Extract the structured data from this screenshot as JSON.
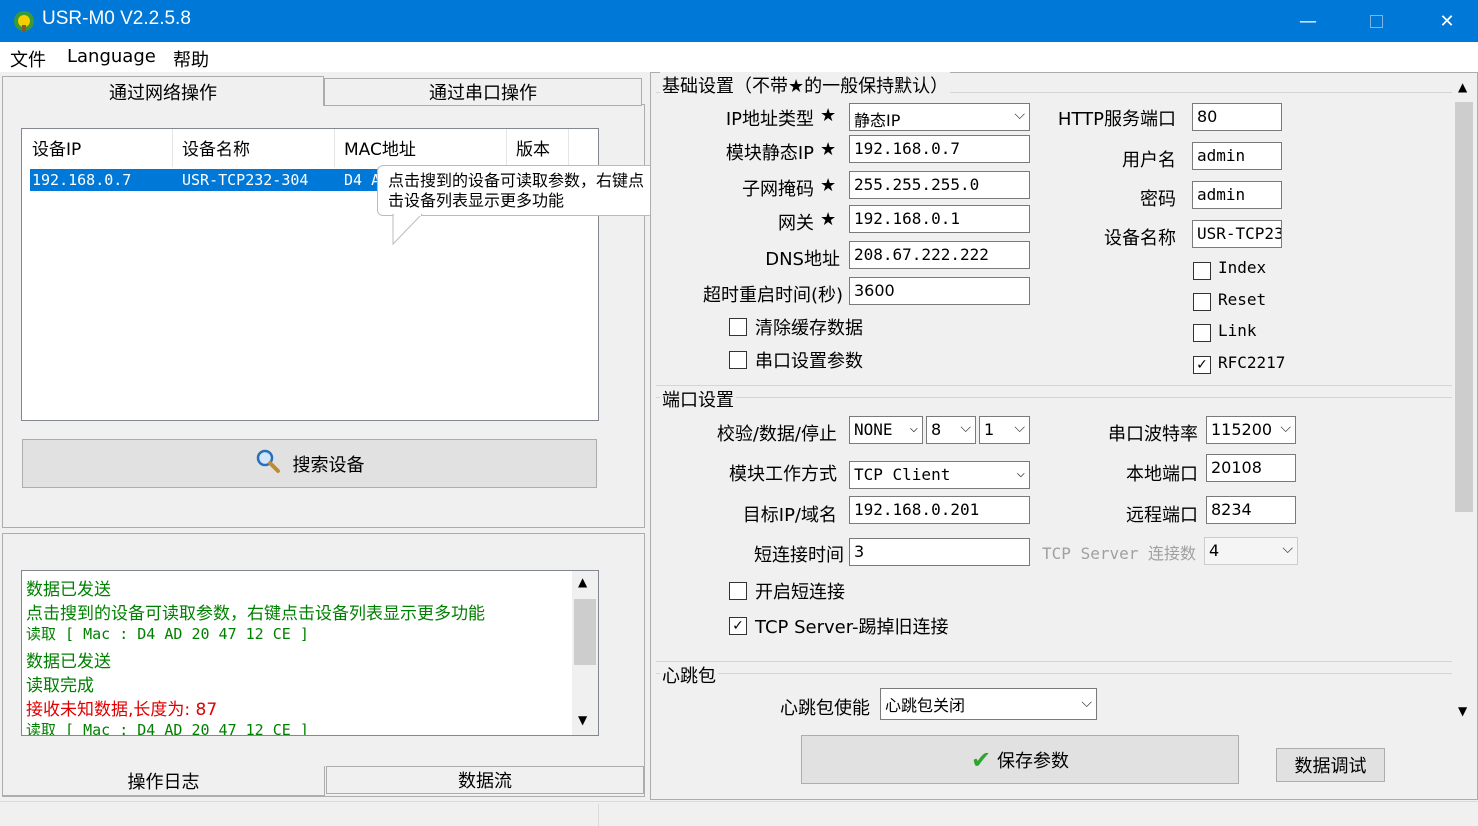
{
  "window": {
    "title": "USR-M0 V2.2.5.8"
  },
  "menu": [
    "文件",
    "Language",
    "帮助"
  ],
  "left": {
    "tabs": [
      "通过网络操作",
      "通过串口操作"
    ],
    "list": {
      "columns": [
        "设备IP",
        "设备名称",
        "MAC地址",
        "版本"
      ],
      "rows": [
        {
          "ip": "192.168.0.7",
          "name": "USR-TCP232-304",
          "mac": "D4 A"
        }
      ]
    },
    "tooltip": [
      "点击搜到的设备可读取参数，右键点",
      "击设备列表显示更多功能"
    ],
    "search_button": "搜索设备",
    "log_lines": [
      {
        "text": "数据已发送",
        "color": "green"
      },
      {
        "text": "点击搜到的设备可读取参数，右键点击设备列表显示更多功能",
        "color": "green"
      },
      {
        "text": "读取 [ Mac : D4 AD 20 47 12 CE ]",
        "color": "green"
      },
      {
        "text": "数据已发送",
        "color": "green"
      },
      {
        "text": "读取完成",
        "color": "green"
      },
      {
        "text": " 接收未知数据,长度为: 87",
        "color": "red"
      },
      {
        "text": "读取 [ Mac : D4 AD 20 47 12 CE ]",
        "color": "green"
      }
    ],
    "bottom_tabs": [
      "操作日志",
      "数据流"
    ]
  },
  "basic": {
    "title": "基础设置（不带★的一般保持默认）",
    "ip_type_label": "IP地址类型",
    "ip_type": "静态IP",
    "static_ip_label": "模块静态IP",
    "static_ip": "192.168.0.7",
    "mask_label": "子网掩码",
    "mask": "255.255.255.0",
    "gateway_label": "网关",
    "gateway": "192.168.0.1",
    "dns_label": "DNS地址",
    "dns": "208.67.222.222",
    "timeout_label": "超时重启时间(秒)",
    "timeout": "3600",
    "clear_cache_label": "清除缓存数据",
    "serial_params_label": "串口设置参数",
    "http_port_label": "HTTP服务端口",
    "http_port": "80",
    "user_label": "用户名",
    "user": "admin",
    "pwd_label": "密码",
    "pwd": "admin",
    "devname_label": "设备名称",
    "devname": "USR-TCP23",
    "index_label": "Index",
    "reset_label": "Reset",
    "link_label": "Link",
    "rfc_label": "RFC2217",
    "star": "★"
  },
  "port": {
    "title": "端口设置",
    "parity_label": "校验/数据/停止",
    "parity": "NONE",
    "databits": "8",
    "stopbits": "1",
    "baud_label": "串口波特率",
    "baud": "115200",
    "mode_label": "模块工作方式",
    "mode": "TCP Client",
    "local_port_label": "本地端口",
    "local_port": "20108",
    "target_label": "目标IP/域名",
    "target": "192.168.0.201",
    "remote_port_label": "远程端口",
    "remote_port": "8234",
    "short_time_label": "短连接时间",
    "short_time": "3",
    "tcp_conn_label": "TCP Server 连接数",
    "tcp_conn": "4",
    "short_conn_label": "开启短连接",
    "kick_label": "TCP Server-踢掉旧连接"
  },
  "heartbeat": {
    "title": "心跳包",
    "enable_label": "心跳包使能",
    "enable": "心跳包关闭"
  },
  "buttons": {
    "save": "保存参数",
    "debug": "数据调试"
  }
}
